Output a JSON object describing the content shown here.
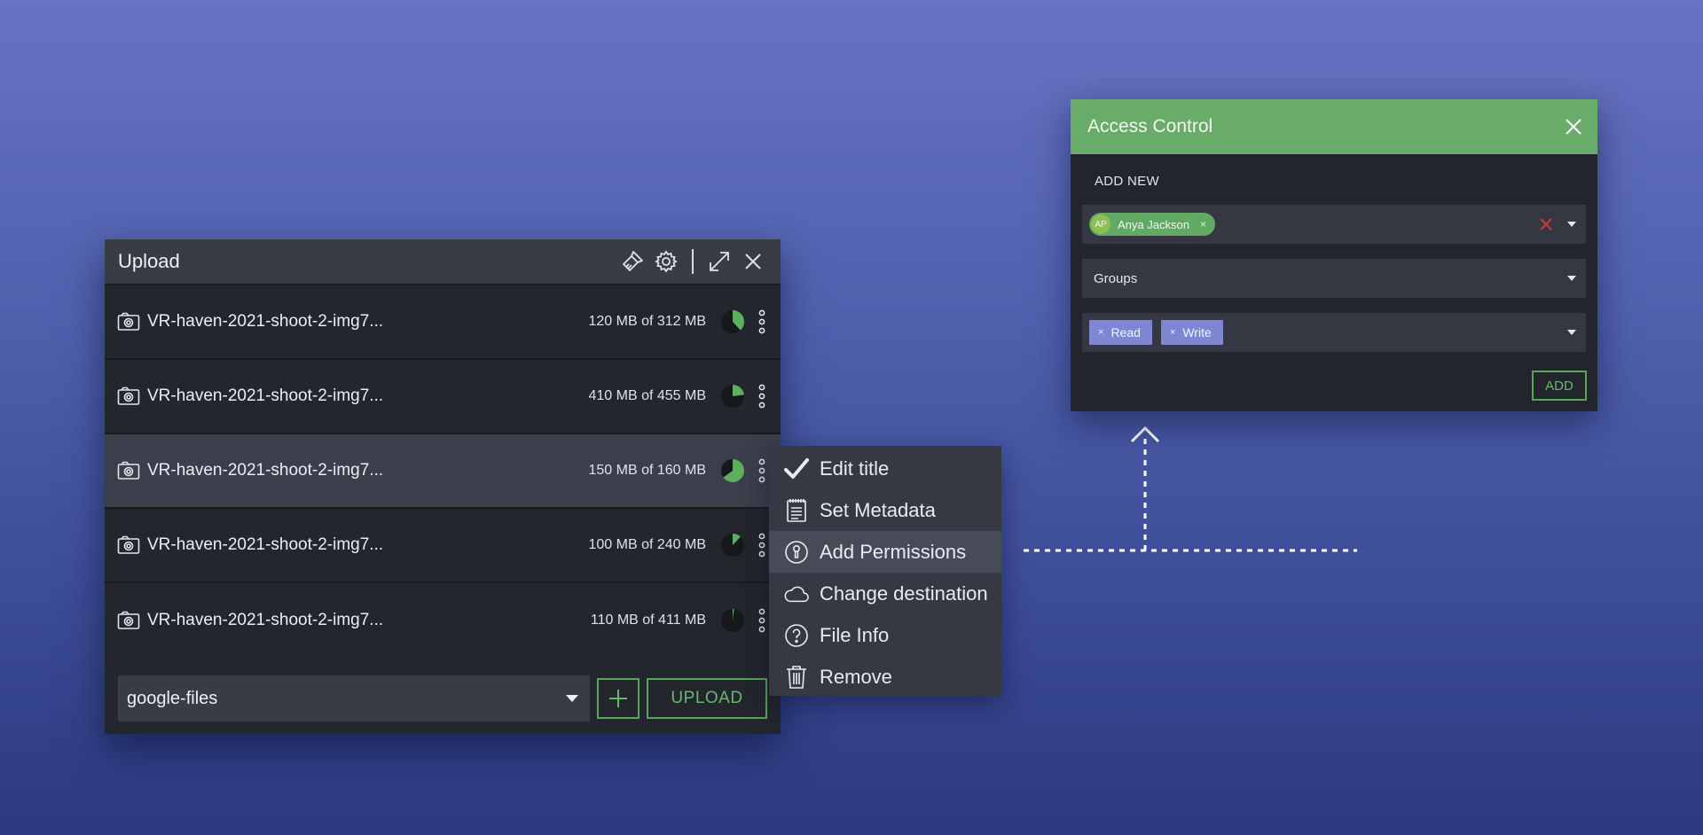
{
  "upload": {
    "title": "Upload",
    "files": [
      {
        "name": "VR-haven-2021-shoot-2-img7...",
        "size": "120 MB of 312 MB",
        "progress": 0.38
      },
      {
        "name": "VR-haven-2021-shoot-2-img7...",
        "size": "410 MB of 455 MB",
        "progress": 0.23
      },
      {
        "name": "VR-haven-2021-shoot-2-img7...",
        "size": "150 MB of 160 MB",
        "progress": 0.65
      },
      {
        "name": "VR-haven-2021-shoot-2-img7...",
        "size": "100 MB of 240 MB",
        "progress": 0.12
      },
      {
        "name": "VR-haven-2021-shoot-2-img7...",
        "size": "110 MB of 411 MB",
        "progress": 0.02
      }
    ],
    "destination": "google-files",
    "upload_label": "UPLOAD",
    "icons": [
      "clean-icon",
      "gear-icon",
      "expand-icon",
      "close-icon",
      "camera-icon",
      "kebab-icon",
      "plus-icon",
      "dropdown-icon"
    ]
  },
  "context_menu": {
    "items": [
      {
        "label": "Edit title",
        "icon": "check-icon"
      },
      {
        "label": "Set Metadata",
        "icon": "notepad-icon"
      },
      {
        "label": "Add Permissions",
        "icon": "lock-icon"
      },
      {
        "label": "Change destination",
        "icon": "cloud-icon"
      },
      {
        "label": "File Info",
        "icon": "question-icon"
      },
      {
        "label": "Remove",
        "icon": "trash-icon"
      }
    ],
    "active_index": 2
  },
  "access_control": {
    "title": "Access Control",
    "subtitle": "ADD NEW",
    "user_chip": {
      "initials": "AP",
      "name": "Anya Jackson"
    },
    "groups_placeholder": "Groups",
    "permissions": [
      "Read",
      "Write"
    ],
    "add_label": "ADD",
    "chip_remove": "×"
  },
  "colors": {
    "accent_green": "#69ab69",
    "progress_green": "#5fae5f",
    "permission_chip": "#7d87d2",
    "clear_red": "#d23b3b"
  }
}
